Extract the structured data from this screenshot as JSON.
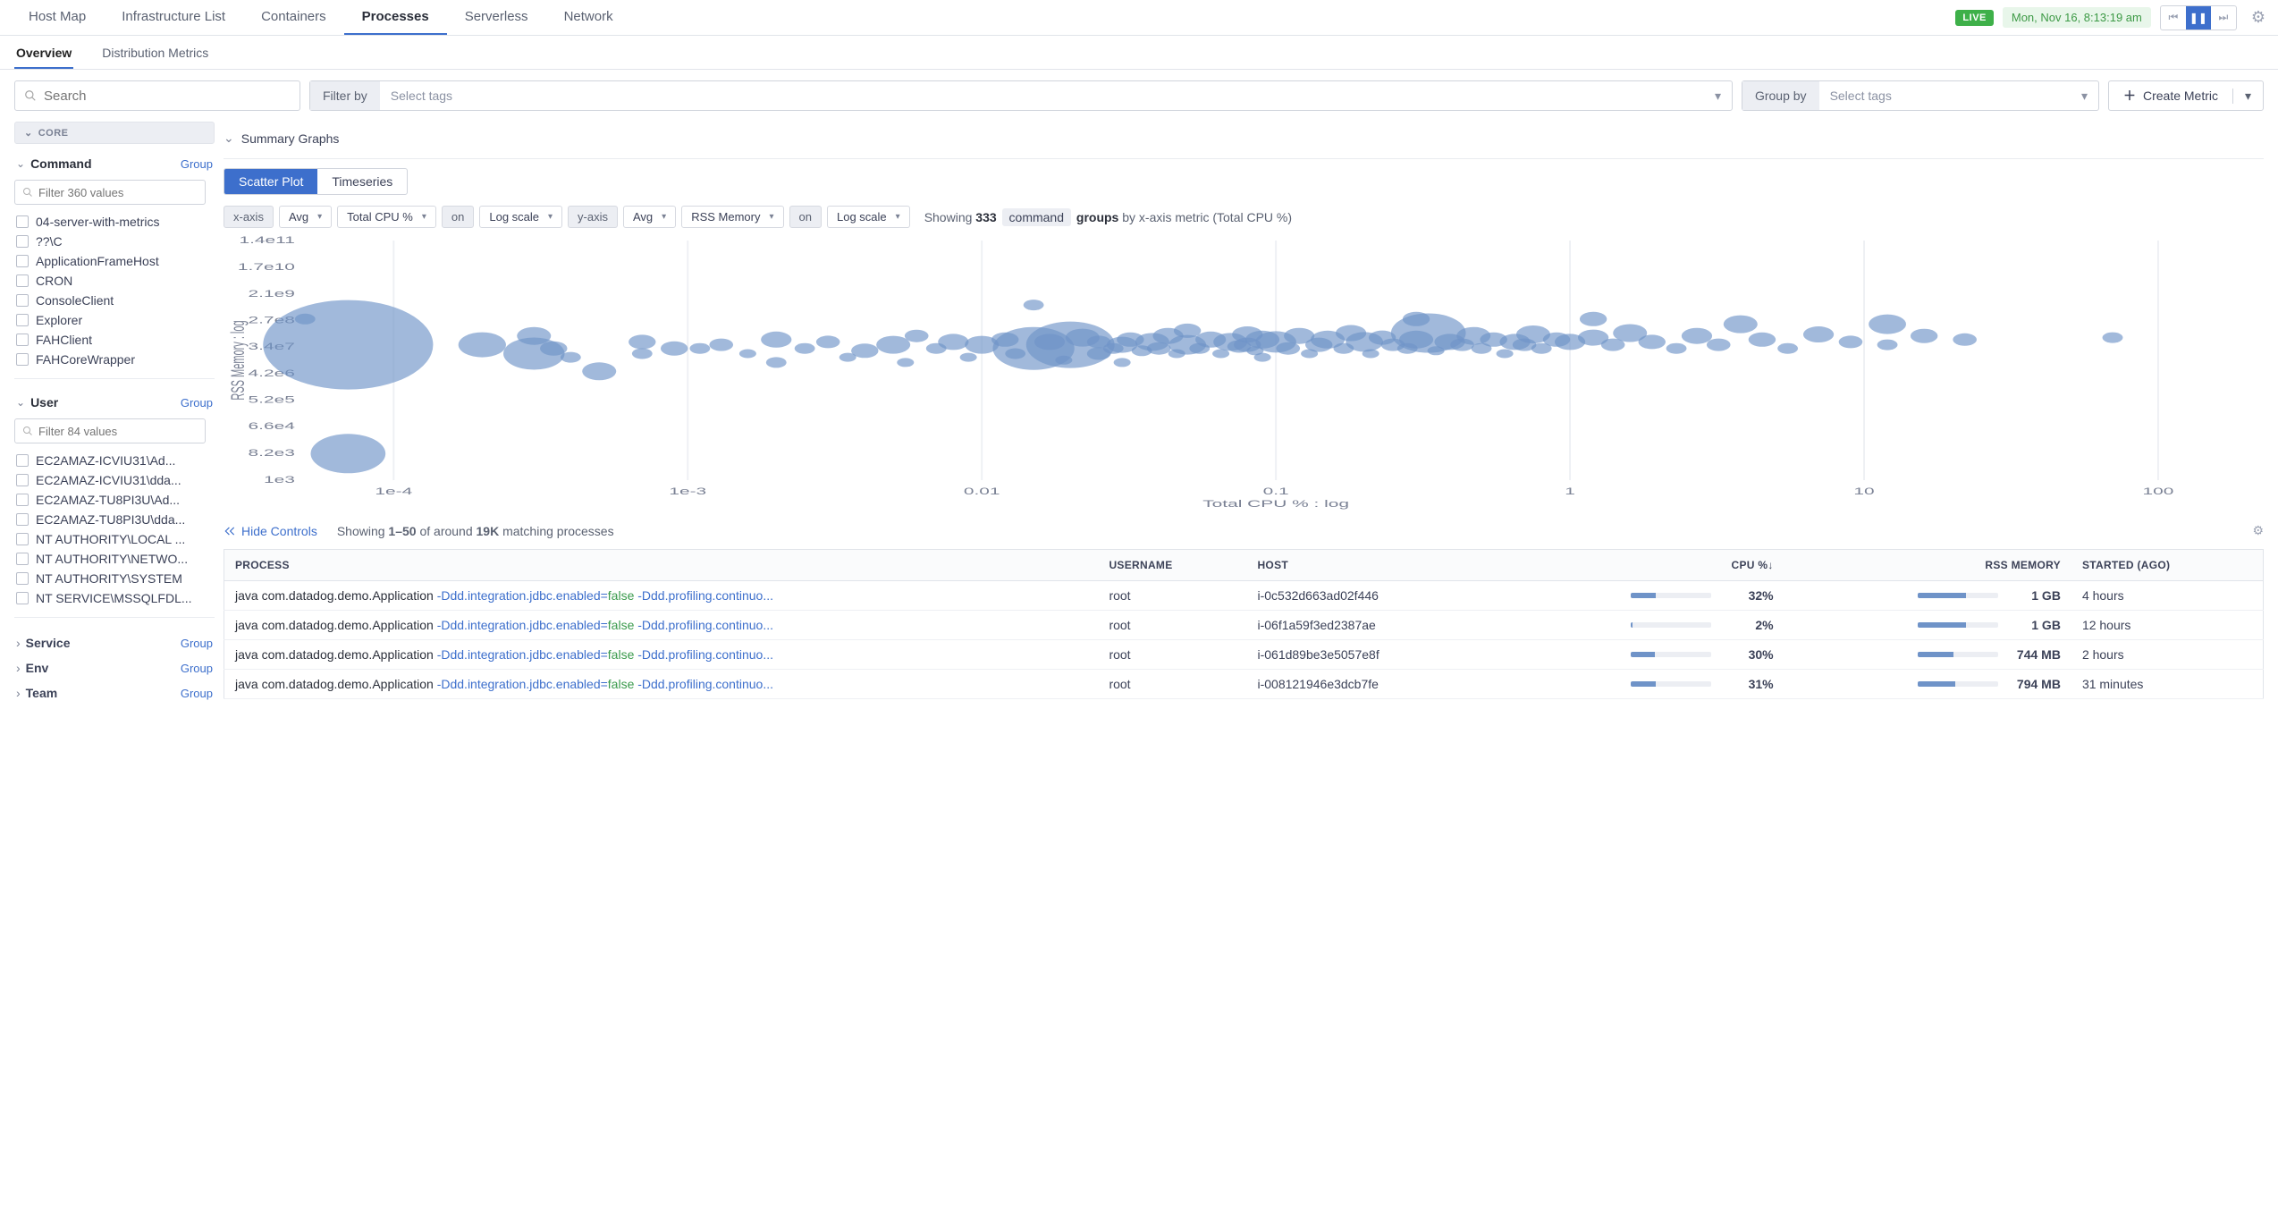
{
  "topnav": {
    "tabs": [
      "Host Map",
      "Infrastructure List",
      "Containers",
      "Processes",
      "Serverless",
      "Network"
    ],
    "active": "Processes",
    "live": "LIVE",
    "time": "Mon, Nov 16, 8:13:19 am"
  },
  "subnav": {
    "tabs": [
      "Overview",
      "Distribution Metrics"
    ],
    "active": "Overview"
  },
  "filterbar": {
    "search_placeholder": "Search",
    "filter_label": "Filter by",
    "filter_placeholder": "Select tags",
    "group_label": "Group by",
    "group_placeholder": "Select tags",
    "create_metric": "Create Metric"
  },
  "sidebar": {
    "core_label": "CORE",
    "group_link": "Group",
    "command": {
      "title": "Command",
      "filter_placeholder": "Filter 360 values",
      "items": [
        "04-server-with-metrics",
        "??\\C",
        "ApplicationFrameHost",
        "CRON",
        "ConsoleClient",
        "Explorer",
        "FAHClient",
        "FAHCoreWrapper"
      ]
    },
    "user": {
      "title": "User",
      "filter_placeholder": "Filter 84 values",
      "items": [
        "EC2AMAZ-ICVIU31\\Ad...",
        "EC2AMAZ-ICVIU31\\dda...",
        "EC2AMAZ-TU8PI3U\\Ad...",
        "EC2AMAZ-TU8PI3U\\dda...",
        "NT AUTHORITY\\LOCAL ...",
        "NT AUTHORITY\\NETWO...",
        "NT AUTHORITY\\SYSTEM",
        "NT SERVICE\\MSSQLFDL..."
      ]
    },
    "collapsed": [
      "Service",
      "Env",
      "Team"
    ]
  },
  "summary": {
    "header": "Summary Graphs",
    "plot_tabs": [
      "Scatter Plot",
      "Timeseries"
    ],
    "plot_active": "Scatter Plot",
    "xaxis": {
      "label": "x-axis",
      "agg": "Avg",
      "metric": "Total CPU %",
      "on": "on",
      "scale": "Log scale"
    },
    "yaxis": {
      "label": "y-axis",
      "agg": "Avg",
      "metric": "RSS Memory",
      "on": "on",
      "scale": "Log scale"
    },
    "showing_count": "333",
    "showing_tag": "command",
    "showing_groups": "groups",
    "showing_suffix": "by x-axis metric (Total CPU %)",
    "showing_prefix": "Showing"
  },
  "chart_data": {
    "type": "scatter",
    "xlabel": "Total CPU % : log",
    "ylabel": "RSS Memory : log",
    "xscale": "log",
    "yscale": "log",
    "xticks": [
      "1e-4",
      "1e-3",
      "0.01",
      "0.1",
      "1",
      "10",
      "100"
    ],
    "yticks": [
      "1e3",
      "8.2e3",
      "6.6e4",
      "5.2e5",
      "4.2e6",
      "3.4e7",
      "2.7e8",
      "2.1e9",
      "1.7e10",
      "1.4e11"
    ],
    "comment": "x/y values approximate (log). size=bubble radius px.",
    "points": [
      {
        "x": 7e-05,
        "y": 40000000.0,
        "size": 50
      },
      {
        "x": 7e-05,
        "y": 8000.0,
        "size": 22
      },
      {
        "x": 5e-05,
        "y": 300000000.0,
        "size": 6
      },
      {
        "x": 0.0002,
        "y": 40000000.0,
        "size": 14
      },
      {
        "x": 0.0003,
        "y": 20000000.0,
        "size": 18
      },
      {
        "x": 0.0003,
        "y": 80000000.0,
        "size": 10
      },
      {
        "x": 0.00035,
        "y": 30000000.0,
        "size": 8
      },
      {
        "x": 0.0004,
        "y": 15000000.0,
        "size": 6
      },
      {
        "x": 0.0005,
        "y": 5000000.0,
        "size": 10
      },
      {
        "x": 0.0007,
        "y": 20000000.0,
        "size": 6
      },
      {
        "x": 0.0007,
        "y": 50000000.0,
        "size": 8
      },
      {
        "x": 0.0009,
        "y": 30000000.0,
        "size": 8
      },
      {
        "x": 0.0011,
        "y": 30000000.0,
        "size": 6
      },
      {
        "x": 0.0013,
        "y": 40000000.0,
        "size": 7
      },
      {
        "x": 0.0016,
        "y": 20000000.0,
        "size": 5
      },
      {
        "x": 0.002,
        "y": 60000000.0,
        "size": 9
      },
      {
        "x": 0.002,
        "y": 10000000.0,
        "size": 6
      },
      {
        "x": 0.0025,
        "y": 30000000.0,
        "size": 6
      },
      {
        "x": 0.003,
        "y": 50000000.0,
        "size": 7
      },
      {
        "x": 0.0035,
        "y": 15000000.0,
        "size": 5
      },
      {
        "x": 0.004,
        "y": 25000000.0,
        "size": 8
      },
      {
        "x": 0.005,
        "y": 40000000.0,
        "size": 10
      },
      {
        "x": 0.0055,
        "y": 10000000.0,
        "size": 5
      },
      {
        "x": 0.006,
        "y": 80000000.0,
        "size": 7
      },
      {
        "x": 0.007,
        "y": 30000000.0,
        "size": 6
      },
      {
        "x": 0.008,
        "y": 50000000.0,
        "size": 9
      },
      {
        "x": 0.009,
        "y": 15000000.0,
        "size": 5
      },
      {
        "x": 0.01,
        "y": 40000000.0,
        "size": 10
      },
      {
        "x": 0.012,
        "y": 60000000.0,
        "size": 8
      },
      {
        "x": 0.013,
        "y": 20000000.0,
        "size": 6
      },
      {
        "x": 0.015,
        "y": 30000000.0,
        "size": 24
      },
      {
        "x": 0.015,
        "y": 900000000.0,
        "size": 6
      },
      {
        "x": 0.017,
        "y": 50000000.0,
        "size": 9
      },
      {
        "x": 0.019,
        "y": 12000000.0,
        "size": 5
      },
      {
        "x": 0.02,
        "y": 40000000.0,
        "size": 26
      },
      {
        "x": 0.022,
        "y": 70000000.0,
        "size": 10
      },
      {
        "x": 0.025,
        "y": 20000000.0,
        "size": 7
      },
      {
        "x": 0.025,
        "y": 50000000.0,
        "size": 7
      },
      {
        "x": 0.028,
        "y": 30000000.0,
        "size": 6
      },
      {
        "x": 0.03,
        "y": 40000000.0,
        "size": 9
      },
      {
        "x": 0.03,
        "y": 10000000.0,
        "size": 5
      },
      {
        "x": 0.032,
        "y": 60000000.0,
        "size": 8
      },
      {
        "x": 0.035,
        "y": 25000000.0,
        "size": 6
      },
      {
        "x": 0.038,
        "y": 50000000.0,
        "size": 10
      },
      {
        "x": 0.04,
        "y": 30000000.0,
        "size": 7
      },
      {
        "x": 0.043,
        "y": 80000000.0,
        "size": 9
      },
      {
        "x": 0.046,
        "y": 20000000.0,
        "size": 5
      },
      {
        "x": 0.05,
        "y": 40000000.0,
        "size": 11
      },
      {
        "x": 0.05,
        "y": 120000000.0,
        "size": 8
      },
      {
        "x": 0.055,
        "y": 30000000.0,
        "size": 6
      },
      {
        "x": 0.06,
        "y": 60000000.0,
        "size": 9
      },
      {
        "x": 0.065,
        "y": 20000000.0,
        "size": 5
      },
      {
        "x": 0.07,
        "y": 50000000.0,
        "size": 10
      },
      {
        "x": 0.075,
        "y": 35000000.0,
        "size": 7
      },
      {
        "x": 0.08,
        "y": 40000000.0,
        "size": 8
      },
      {
        "x": 0.08,
        "y": 90000000.0,
        "size": 9
      },
      {
        "x": 0.085,
        "y": 25000000.0,
        "size": 5
      },
      {
        "x": 0.09,
        "y": 60000000.0,
        "size": 10
      },
      {
        "x": 0.09,
        "y": 15000000.0,
        "size": 5
      },
      {
        "x": 0.1,
        "y": 50000000.0,
        "size": 12
      },
      {
        "x": 0.11,
        "y": 30000000.0,
        "size": 7
      },
      {
        "x": 0.12,
        "y": 80000000.0,
        "size": 9
      },
      {
        "x": 0.13,
        "y": 20000000.0,
        "size": 5
      },
      {
        "x": 0.14,
        "y": 40000000.0,
        "size": 8
      },
      {
        "x": 0.15,
        "y": 60000000.0,
        "size": 10
      },
      {
        "x": 0.17,
        "y": 30000000.0,
        "size": 6
      },
      {
        "x": 0.18,
        "y": 100000000.0,
        "size": 9
      },
      {
        "x": 0.2,
        "y": 50000000.0,
        "size": 11
      },
      {
        "x": 0.21,
        "y": 20000000.0,
        "size": 5
      },
      {
        "x": 0.23,
        "y": 70000000.0,
        "size": 8
      },
      {
        "x": 0.25,
        "y": 40000000.0,
        "size": 7
      },
      {
        "x": 0.28,
        "y": 30000000.0,
        "size": 6
      },
      {
        "x": 0.3,
        "y": 60000000.0,
        "size": 10
      },
      {
        "x": 0.3,
        "y": 300000000.0,
        "size": 8
      },
      {
        "x": 0.33,
        "y": 100000000.0,
        "size": 22
      },
      {
        "x": 0.35,
        "y": 25000000.0,
        "size": 5
      },
      {
        "x": 0.39,
        "y": 50000000.0,
        "size": 9
      },
      {
        "x": 0.43,
        "y": 40000000.0,
        "size": 7
      },
      {
        "x": 0.47,
        "y": 80000000.0,
        "size": 10
      },
      {
        "x": 0.5,
        "y": 30000000.0,
        "size": 6
      },
      {
        "x": 0.55,
        "y": 60000000.0,
        "size": 8
      },
      {
        "x": 0.6,
        "y": 20000000.0,
        "size": 5
      },
      {
        "x": 0.65,
        "y": 50000000.0,
        "size": 9
      },
      {
        "x": 0.7,
        "y": 40000000.0,
        "size": 7
      },
      {
        "x": 0.75,
        "y": 90000000.0,
        "size": 10
      },
      {
        "x": 0.8,
        "y": 30000000.0,
        "size": 6
      },
      {
        "x": 0.9,
        "y": 60000000.0,
        "size": 8
      },
      {
        "x": 1,
        "y": 50000000.0,
        "size": 9
      },
      {
        "x": 1.2,
        "y": 70000000.0,
        "size": 9
      },
      {
        "x": 1.2,
        "y": 300000000.0,
        "size": 8
      },
      {
        "x": 1.4,
        "y": 40000000.0,
        "size": 7
      },
      {
        "x": 1.6,
        "y": 100000000.0,
        "size": 10
      },
      {
        "x": 1.9,
        "y": 50000000.0,
        "size": 8
      },
      {
        "x": 2.3,
        "y": 30000000.0,
        "size": 6
      },
      {
        "x": 2.7,
        "y": 80000000.0,
        "size": 9
      },
      {
        "x": 3.2,
        "y": 40000000.0,
        "size": 7
      },
      {
        "x": 3.8,
        "y": 200000000.0,
        "size": 10
      },
      {
        "x": 4.5,
        "y": 60000000.0,
        "size": 8
      },
      {
        "x": 5.5,
        "y": 30000000.0,
        "size": 6
      },
      {
        "x": 7,
        "y": 90000000.0,
        "size": 9
      },
      {
        "x": 9,
        "y": 50000000.0,
        "size": 7
      },
      {
        "x": 12,
        "y": 40000000.0,
        "size": 6
      },
      {
        "x": 12,
        "y": 200000000.0,
        "size": 11
      },
      {
        "x": 16,
        "y": 80000000.0,
        "size": 8
      },
      {
        "x": 22,
        "y": 60000000.0,
        "size": 7
      },
      {
        "x": 70,
        "y": 70000000.0,
        "size": 6
      }
    ]
  },
  "table_controls": {
    "hide": "Hide Controls",
    "showing_a": "Showing ",
    "range": "1–50",
    "showing_b": " of around ",
    "total": "19K",
    "showing_c": " matching processes"
  },
  "table": {
    "headers": {
      "process": "PROCESS",
      "username": "USERNAME",
      "host": "HOST",
      "cpu": "CPU %↓",
      "mem": "RSS MEMORY",
      "started": "STARTED (AGO)"
    },
    "cmd_base": "java com.datadog.demo.Application ",
    "cmd_arg1": "-Ddd.integration.jdbc.enabled=",
    "cmd_val": "false",
    "cmd_arg2": " -Ddd.profiling.continuo...",
    "rows": [
      {
        "user": "root",
        "host": "i-0c532d663ad02f446",
        "cpu": "32%",
        "cpu_pct": 32,
        "mem": "1 GB",
        "mem_pct": 60,
        "started": "4 hours"
      },
      {
        "user": "root",
        "host": "i-06f1a59f3ed2387ae",
        "cpu": "2%",
        "cpu_pct": 3,
        "mem": "1 GB",
        "mem_pct": 60,
        "started": "12 hours"
      },
      {
        "user": "root",
        "host": "i-061d89be3e5057e8f",
        "cpu": "30%",
        "cpu_pct": 30,
        "mem": "744 MB",
        "mem_pct": 44,
        "started": "2 hours"
      },
      {
        "user": "root",
        "host": "i-008121946e3dcb7fe",
        "cpu": "31%",
        "cpu_pct": 31,
        "mem": "794 MB",
        "mem_pct": 47,
        "started": "31 minutes"
      }
    ]
  }
}
